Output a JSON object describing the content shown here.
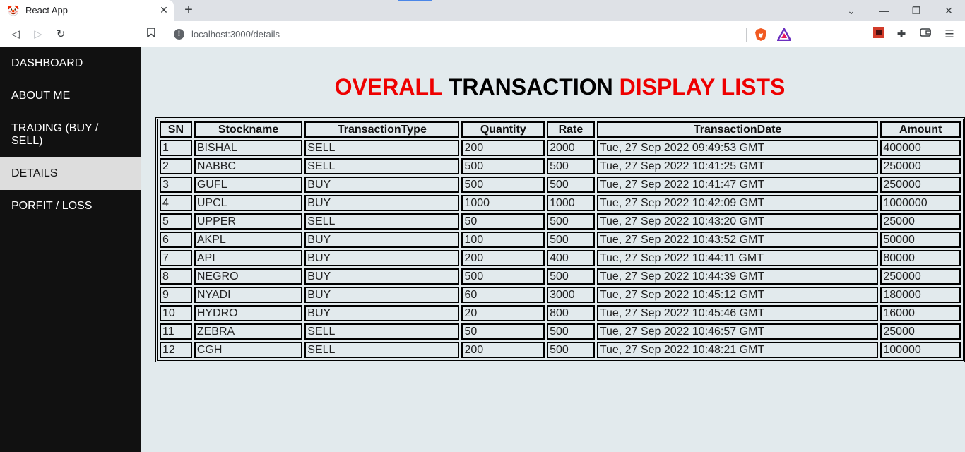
{
  "browser": {
    "tab_title": "React App",
    "url": "localhost:3000/details"
  },
  "sidebar": {
    "items": [
      {
        "label": "DASHBOARD",
        "active": false
      },
      {
        "label": "ABOUT ME",
        "active": false
      },
      {
        "label": "TRADING (BUY / SELL)",
        "active": false
      },
      {
        "label": "DETAILS",
        "active": true
      },
      {
        "label": "PORFIT / LOSS",
        "active": false
      }
    ]
  },
  "page": {
    "title_parts": [
      "OVERALL",
      "TRANSACTION",
      "DISPLAY LISTS"
    ]
  },
  "table": {
    "columns": [
      "SN",
      "Stockname",
      "TransactionType",
      "Quantity",
      "Rate",
      "TransactionDate",
      "Amount"
    ],
    "rows": [
      [
        "1",
        "BISHAL",
        "SELL",
        "200",
        "2000",
        "Tue, 27 Sep 2022 09:49:53 GMT",
        "400000"
      ],
      [
        "2",
        "NABBC",
        "SELL",
        "500",
        "500",
        "Tue, 27 Sep 2022 10:41:25 GMT",
        "250000"
      ],
      [
        "3",
        "GUFL",
        "BUY",
        "500",
        "500",
        "Tue, 27 Sep 2022 10:41:47 GMT",
        "250000"
      ],
      [
        "4",
        "UPCL",
        "BUY",
        "1000",
        "1000",
        "Tue, 27 Sep 2022 10:42:09 GMT",
        "1000000"
      ],
      [
        "5",
        "UPPER",
        "SELL",
        "50",
        "500",
        "Tue, 27 Sep 2022 10:43:20 GMT",
        "25000"
      ],
      [
        "6",
        "AKPL",
        "BUY",
        "100",
        "500",
        "Tue, 27 Sep 2022 10:43:52 GMT",
        "50000"
      ],
      [
        "7",
        "API",
        "BUY",
        "200",
        "400",
        "Tue, 27 Sep 2022 10:44:11 GMT",
        "80000"
      ],
      [
        "8",
        "NEGRO",
        "BUY",
        "500",
        "500",
        "Tue, 27 Sep 2022 10:44:39 GMT",
        "250000"
      ],
      [
        "9",
        "NYADI",
        "BUY",
        "60",
        "3000",
        "Tue, 27 Sep 2022 10:45:12 GMT",
        "180000"
      ],
      [
        "10",
        "HYDRO",
        "BUY",
        "20",
        "800",
        "Tue, 27 Sep 2022 10:45:46 GMT",
        "16000"
      ],
      [
        "11",
        "ZEBRA",
        "SELL",
        "50",
        "500",
        "Tue, 27 Sep 2022 10:46:57 GMT",
        "25000"
      ],
      [
        "12",
        "CGH",
        "SELL",
        "200",
        "500",
        "Tue, 27 Sep 2022 10:48:21 GMT",
        "100000"
      ]
    ]
  },
  "colors": {
    "sidebar_bg": "#111111",
    "active_item_bg": "#dddddd",
    "content_bg": "#e2eaed",
    "title_accent": "#ee0000"
  }
}
